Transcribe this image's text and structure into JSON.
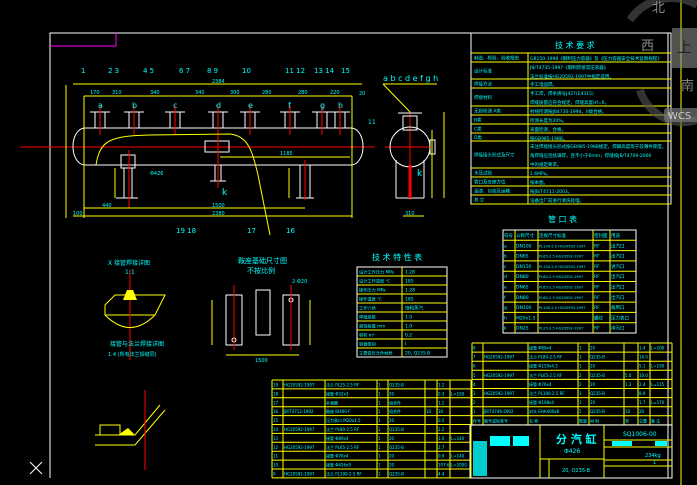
{
  "viewcube": {
    "north": "北",
    "west": "西",
    "top": "上",
    "south": "南",
    "wcs": "WCS"
  },
  "colors": {
    "background": "#000000",
    "text": "#00ffff",
    "table_lines": "#ffff00",
    "outline": "#ffffff",
    "centerline": "#ff0000",
    "layer_marker": "#ff00ff"
  },
  "drawing": {
    "part_balloons_top": [
      "1",
      "2 3",
      "4 5",
      "6 7",
      "8 9",
      "10",
      "11 12",
      "13 14",
      "15"
    ],
    "part_balloons_bottom": [
      "19 18",
      "17",
      "16"
    ],
    "nozzle_labels": [
      "a",
      "b",
      "c",
      "d",
      "e",
      "f",
      "g",
      "h"
    ],
    "side_nozzle_labels": "a b c d e f g h",
    "drain_label": "k",
    "top_dims": [
      "170",
      "310",
      "340",
      "340",
      "300",
      "280",
      "280",
      "220"
    ],
    "overall_top_dim": "2384",
    "overall_bottom_dim": "2380",
    "dim_440": "440",
    "dim_1500": "1500",
    "dim_1185": "1185",
    "dim_100": "100",
    "dim_diameter": "Φ426",
    "dim_310": "310",
    "dim_20": "20",
    "side_part": "11"
  },
  "details": {
    "weld_detail_title": "X 接管焊接详图",
    "weld_detail_scale": "1:1",
    "flange_detail_title": "接管与法兰焊接详图",
    "flange_detail_note": "1:4 (所有法兰焊缝同)",
    "saddle_title": "鞍座基础尺寸图",
    "saddle_note": "不按比例",
    "saddle_dim": "2-Φ20",
    "saddle_dim2": "1500"
  },
  "tech_requirements": {
    "title": "技 术 要 求",
    "rows": [
      {
        "label": "制造、检验、验收规范",
        "lines": [
          "GB150-1998《钢制压力容器》及《压力容器安全技术监察规程》"
        ]
      },
      {
        "label": "设计标准",
        "lines": [
          "JB/T4735-1997《钢制焊接常压容器》",
          "法兰标准按HG20592-1997中规定选用。"
        ]
      },
      {
        "label": "焊接方法",
        "lines": [
          "手工电弧焊。"
        ]
      },
      {
        "label": "焊接材料",
        "lines": [
          "手工焊，焊条牌号J427(E4315)",
          "焊缝质量应符合规定，焊缝高度Hf=6。"
        ]
      },
      {
        "label": "无损检测 A类",
        "lines": [
          "射线检测按JB4730-1994，II级合格。"
        ]
      },
      {
        "label": "B类",
        "lines": [
          "检测长度为20%。"
        ]
      },
      {
        "label": "C类",
        "lines": [
          "表面检测，合格。"
        ]
      },
      {
        "label": "D类",
        "lines": [
          "按GB985-1988。"
        ]
      },
      {
        "label": "焊接接头形式及尺寸",
        "lines": [
          "未注焊接接头形式按GB985-1988规定，焊脚高度等于较薄件厚度，",
          "角焊缝应连续满焊，且不小于6mm，焊缝按JB/T4709-2000",
          "中的规定要求。"
        ]
      },
      {
        "label": "水压试验",
        "lines": [
          "1.6MPa。"
        ]
      },
      {
        "label": "管口及支座方位",
        "lines": [
          "按本图。"
        ]
      },
      {
        "label": "油漆、包装及运输",
        "lines": [
          "按JB/T4711-2003。"
        ]
      },
      {
        "label": "其 它",
        "lines": [
          "设备出厂前进行清洗处理。"
        ]
      }
    ]
  },
  "nozzle_table": {
    "title": "管 口 表",
    "headers": [
      "符号",
      "公称尺寸",
      "连接尺寸标准",
      "密封面",
      "用途"
    ],
    "rows": [
      [
        "a",
        "DN100",
        "PL100-2.5 HG20592-1997",
        "RF",
        "出汽口"
      ],
      [
        "b",
        "DN65",
        "PL65-2.5 HG20592-1997",
        "RF",
        "出汽口"
      ],
      [
        "c",
        "DN150",
        "PL150-2.5 HG20592-1997",
        "RF",
        "进汽口"
      ],
      [
        "d",
        "DN80",
        "PL80-2.5 HG20592-1997",
        "RF",
        "出汽口"
      ],
      [
        "e",
        "DN65",
        "PL65-2.5 HG20592-1997",
        "RF",
        "出汽口"
      ],
      [
        "f",
        "DN80",
        "PL80-2.5 HG20592-1997",
        "RF",
        "出汽口"
      ],
      [
        "g",
        "DN100",
        "PL100-2.5 HG20592-1997",
        "RF",
        "备用口"
      ],
      [
        "h",
        "M20x1.5",
        "",
        "螺纹",
        "压力表口"
      ],
      [
        "k",
        "DN25",
        "PL25-2.5 HG20592-1997",
        "RF",
        "排污口"
      ]
    ]
  },
  "tech_characteristics": {
    "title": "技 术 特 性 表",
    "rows": [
      [
        "设计工作压力 MPa",
        "1.28"
      ],
      [
        "设计工作温度 ℃",
        "185"
      ],
      [
        "操作压力 MPa",
        "1.28"
      ],
      [
        "操作温度 ℃",
        "185"
      ],
      [
        "工作介质",
        "饱和蒸汽"
      ],
      [
        "焊缝系数",
        "1.0"
      ],
      [
        "腐蚀裕量 mm",
        "1.0"
      ],
      [
        "容积 m³",
        "0.2"
      ],
      [
        "容器类别",
        "I"
      ],
      [
        "主要受压元件材质",
        "20, Q235-B"
      ]
    ]
  },
  "parts_list_right": {
    "rows": [
      [
        "8",
        "",
        "接管 Φ89x4",
        "1",
        "20",
        "",
        "1.4",
        "L=100"
      ],
      [
        "7",
        "HG20592-1997",
        "法兰 PL80-2.5 RF",
        "1",
        "Q235-B",
        "",
        "14.0",
        ""
      ],
      [
        "6",
        "",
        "接管 Φ159x4.5",
        "1",
        "20",
        "",
        "5.1",
        "L=150"
      ],
      [
        "5",
        "HG20592-1997",
        "法兰 PL65-2.5 RF",
        "2",
        "Q235-B",
        "5.0",
        "10.0",
        ""
      ],
      [
        "4",
        "",
        "接管 Φ76x4",
        "2",
        "20",
        "1.2",
        "2.4",
        "L=115"
      ],
      [
        "3",
        "HG20592-1997",
        "法兰 PL100-2.5 RF",
        "1",
        "Q235-B",
        "",
        "8.9",
        ""
      ],
      [
        "2",
        "",
        "接管 Φ108x4",
        "1",
        "20",
        "",
        "1.7",
        "L=170"
      ],
      [
        "1",
        "JB/T4746-2002",
        "封头 EHA400x8",
        "2",
        "Q235-B",
        "10",
        "20",
        ""
      ],
      [
        "件号",
        "图号或标准号",
        "名 称",
        "数量",
        "材 料",
        "单",
        "总重",
        "备 注"
      ]
    ]
  },
  "parts_list_left": {
    "rows": [
      [
        "19",
        "HG20592-1997",
        "法兰 PL25-2.5 RF",
        "1",
        "Q235-B",
        "",
        "1.2",
        ""
      ],
      [
        "18",
        "",
        "接管 Φ32x3",
        "1",
        "20",
        "",
        "0.3",
        "L=150"
      ],
      [
        "17",
        "",
        "补强圈",
        "1",
        "组合件",
        "",
        "1.2",
        ""
      ],
      [
        "16",
        "JB/T4712-1992",
        "鞍座 BI400-F",
        "1",
        "组合件",
        "10",
        "30",
        ""
      ],
      [
        "15",
        "",
        "压力表口 M20x1.5",
        "1",
        "20",
        "",
        "0.5",
        ""
      ],
      [
        "14",
        "HG20592-1997",
        "法兰 PL80-2.5 RF",
        "1",
        "Q235-B",
        "",
        "2.2",
        ""
      ],
      [
        "13",
        "",
        "接管 Φ89x4",
        "1",
        "20",
        "",
        "1.0",
        "L=140"
      ],
      [
        "12",
        "HG20592-1997",
        "法兰 PL65-2.5 RF",
        "1",
        "Q235-B",
        "",
        "2.7",
        ""
      ],
      [
        "11",
        "",
        "接管 Φ76x4",
        "1",
        "20",
        "",
        "0.9",
        "L=140"
      ],
      [
        "10",
        "",
        "接管 Φ426x9",
        "1",
        "20",
        "",
        "107.6",
        "L=2000"
      ],
      [
        "9",
        "HG20592-1997",
        "法兰 PL100-2.5 RF",
        "1",
        "Q235-B",
        "",
        "4.4",
        ""
      ]
    ]
  },
  "title_block": {
    "name": "分 汽 缸",
    "spec": "Φ426",
    "drawing_no": "SQ1006-00",
    "weight": "234kg",
    "scale": "1",
    "material": "20, Q235-B"
  }
}
